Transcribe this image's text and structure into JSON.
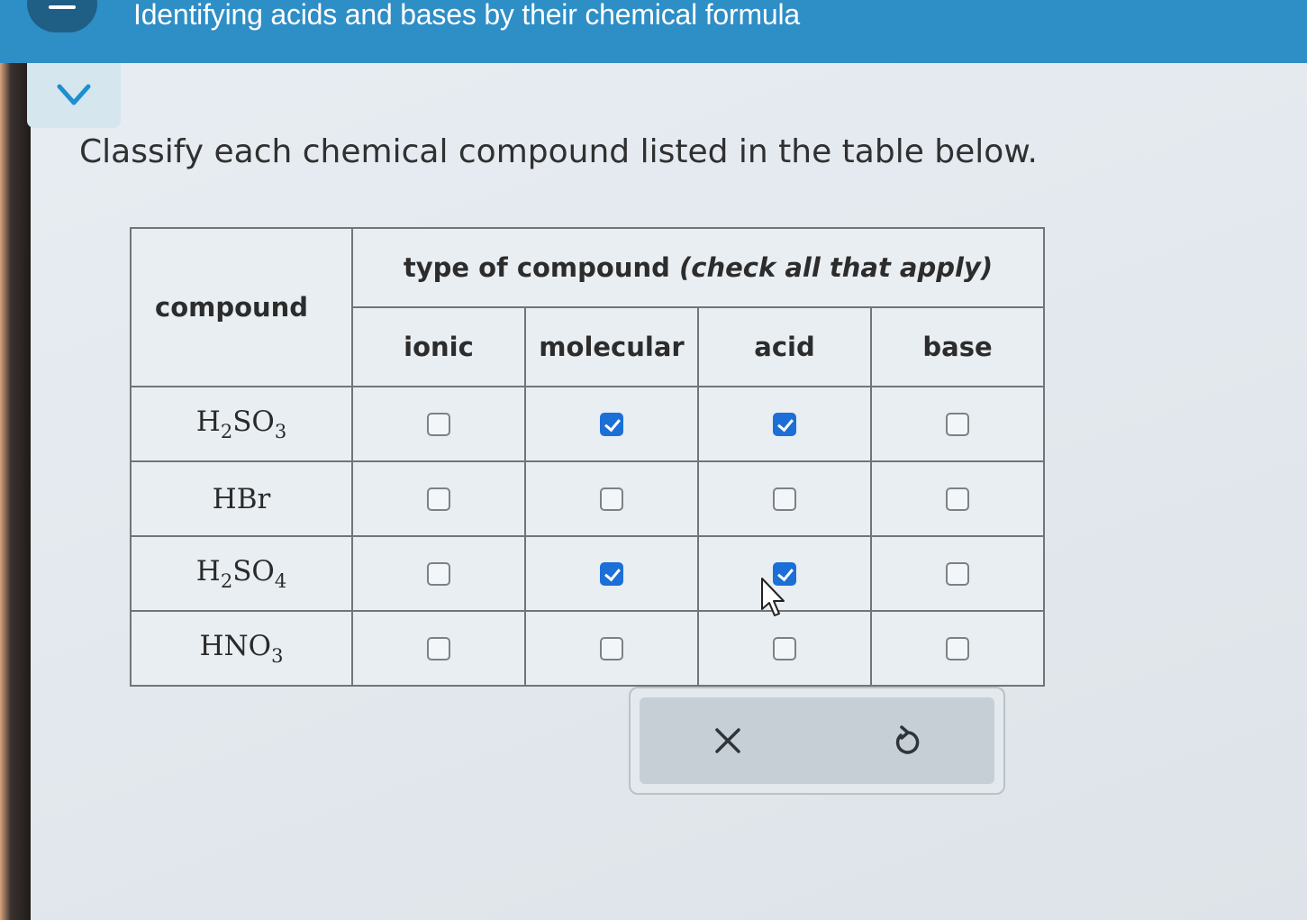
{
  "header": {
    "title": "Identifying acids and bases by their chemical formula"
  },
  "prompt": "Classify each chemical compound listed in the table below.",
  "table": {
    "compound_header": "compound",
    "group_header_main": "type of compound",
    "group_header_note": "(check all that apply)",
    "columns": [
      "ionic",
      "molecular",
      "acid",
      "base"
    ],
    "rows": [
      {
        "formula_base": [
          "H",
          "SO"
        ],
        "formula_subs": [
          "2",
          "3"
        ],
        "checks": [
          false,
          true,
          true,
          false
        ]
      },
      {
        "formula_plain": "HBr",
        "checks": [
          false,
          false,
          false,
          false
        ]
      },
      {
        "formula_base": [
          "H",
          "SO"
        ],
        "formula_subs": [
          "2",
          "4"
        ],
        "checks": [
          false,
          true,
          true,
          false
        ]
      },
      {
        "formula_base": [
          "HNO"
        ],
        "formula_subs": [
          "3"
        ],
        "checks": [
          false,
          false,
          false,
          false
        ]
      }
    ]
  },
  "actions": {
    "clear_icon": "x-icon",
    "undo_icon": "undo-icon"
  },
  "colors": {
    "header": "#2e8ec6",
    "checkbox_checked": "#1b6fd6"
  }
}
